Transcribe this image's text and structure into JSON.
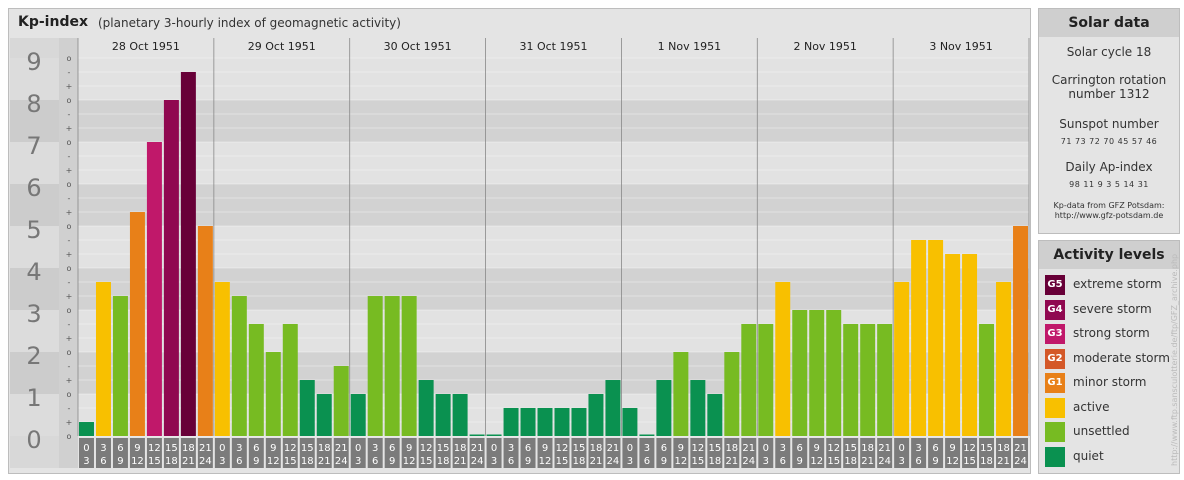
{
  "header": {
    "title": "Kp-index",
    "subtitle": "(planetary 3-hourly index of geomagnetic activity)"
  },
  "chart_data": {
    "type": "bar",
    "title": "Kp-index",
    "subtitle": "(planetary 3-hourly index of geomagnetic activity)",
    "ylim": [
      0,
      9
    ],
    "y_ticks": [
      "0",
      "1",
      "2",
      "3",
      "4",
      "5",
      "6",
      "7",
      "8",
      "9"
    ],
    "minor_tick_labels": [
      "+",
      "-",
      "o"
    ],
    "days": [
      "28 Oct 1951",
      "29 Oct 1951",
      "30 Oct 1951",
      "31 Oct 1951",
      "1 Nov 1951",
      "2 Nov 1951",
      "3 Nov 1951"
    ],
    "interval_labels": [
      [
        "0",
        "3"
      ],
      [
        "3",
        "6"
      ],
      [
        "6",
        "9"
      ],
      [
        "9",
        "12"
      ],
      [
        "12",
        "15"
      ],
      [
        "15",
        "18"
      ],
      [
        "18",
        "21"
      ],
      [
        "21",
        "24"
      ]
    ],
    "values": [
      [
        0.333,
        3.667,
        3.333,
        5.333,
        7.0,
        8.0,
        8.667,
        5.0
      ],
      [
        3.667,
        3.333,
        2.667,
        2.0,
        2.667,
        1.333,
        1.0,
        1.667
      ],
      [
        1.0,
        3.333,
        3.333,
        3.333,
        1.333,
        1.0,
        1.0,
        0.0
      ],
      [
        0.0,
        0.667,
        0.667,
        0.667,
        0.667,
        0.667,
        1.0,
        1.333
      ],
      [
        0.667,
        0.0,
        1.333,
        2.0,
        1.333,
        1.0,
        2.0,
        2.667
      ],
      [
        2.667,
        3.667,
        3.0,
        3.0,
        3.0,
        2.667,
        2.667,
        2.667
      ],
      [
        3.667,
        4.667,
        4.667,
        4.333,
        4.333,
        2.667,
        3.667,
        5.0
      ]
    ],
    "colors": {
      "quiet": "#0a9150",
      "unsettled": "#77bb22",
      "active": "#f8c000",
      "G1": "#e88018",
      "G2": "#d45828",
      "G3": "#c0186a",
      "G4": "#900850",
      "G5": "#680038"
    },
    "grid": true
  },
  "solar": {
    "heading": "Solar data",
    "cycle": "Solar cycle 18",
    "carrington": "Carrington rotation number 1312",
    "sunspot_label": "Sunspot number",
    "sunspot_values": "71 73 72 70 45 57 46",
    "ap_label": "Daily Ap-index",
    "ap_values": "98 11 9 3 5 14 31",
    "source_line1": "Kp-data from GFZ Potsdam:",
    "source_line2": "http://www.gfz-potsdam.de"
  },
  "activity": {
    "heading": "Activity levels",
    "levels": [
      {
        "badge": "G5",
        "label": "extreme storm",
        "color": "#680038"
      },
      {
        "badge": "G4",
        "label": "severe storm",
        "color": "#900850"
      },
      {
        "badge": "G3",
        "label": "strong storm",
        "color": "#c0186a"
      },
      {
        "badge": "G2",
        "label": "moderate storm",
        "color": "#d45828"
      },
      {
        "badge": "G1",
        "label": "minor storm",
        "color": "#e88018"
      },
      {
        "badge": "",
        "label": "active",
        "color": "#f8c000"
      },
      {
        "badge": "",
        "label": "unsettled",
        "color": "#77bb22"
      },
      {
        "badge": "",
        "label": "quiet",
        "color": "#0a9150"
      }
    ]
  },
  "credit": "http://www.ftp.sansculotterie.de/ftp/GFZ_archive.php"
}
